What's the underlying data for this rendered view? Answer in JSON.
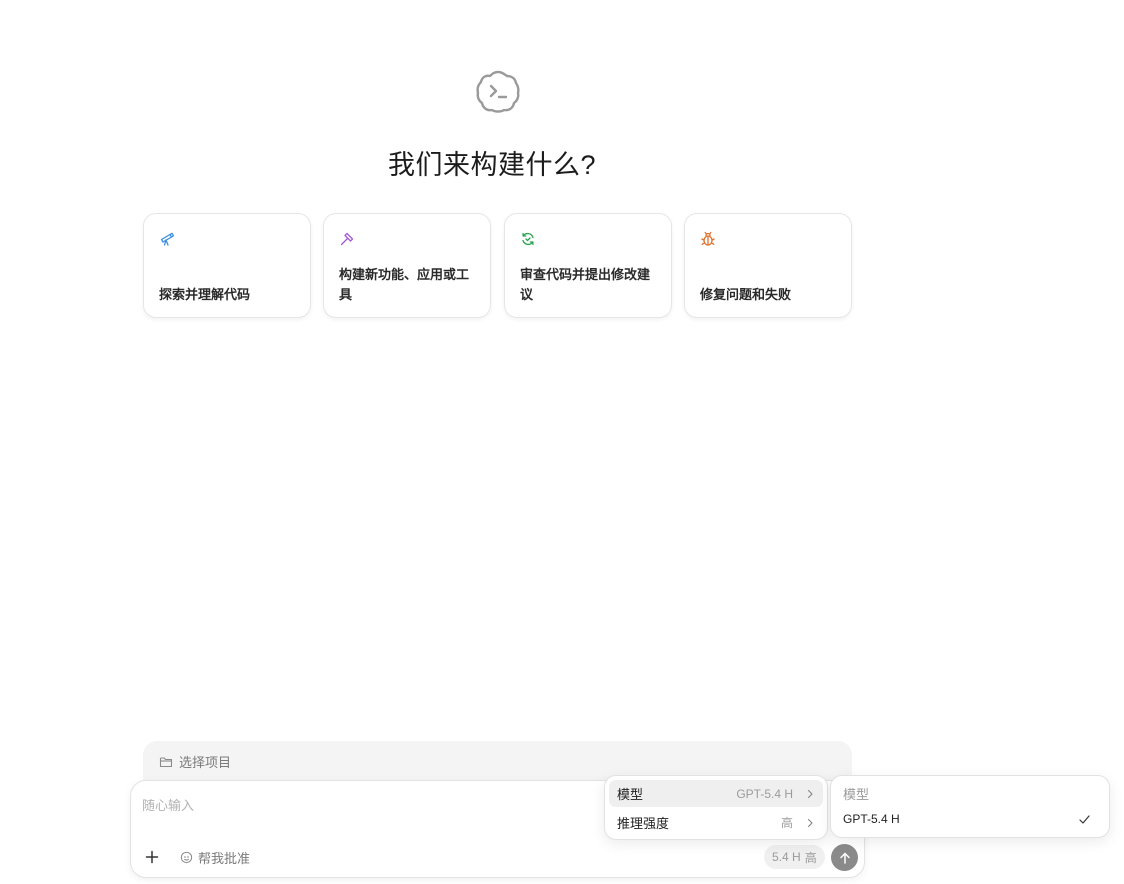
{
  "headline": "我们来构建什么?",
  "suggestions": [
    {
      "icon": "telescope-icon",
      "label": "探索并理解代码",
      "color": "#3b8fe0"
    },
    {
      "icon": "hammer-icon",
      "label": "构建新功能、应用或工具",
      "color": "#a35ad8"
    },
    {
      "icon": "review-refresh-icon",
      "label": "审查代码并提出修改建议",
      "color": "#2aa44f"
    },
    {
      "icon": "bug-icon",
      "label": "修复问题和失败",
      "color": "#e0702c"
    }
  ],
  "project_bar": {
    "label": "选择项目",
    "icon": "folder-icon"
  },
  "composer": {
    "placeholder": "随心输入",
    "approve_label": "帮我批准",
    "model_chip": {
      "model": "5.4 H",
      "effort": "高"
    }
  },
  "model_menu": {
    "items": [
      {
        "label": "模型",
        "value": "GPT-5.4 H"
      },
      {
        "label": "推理强度",
        "value": "高"
      }
    ]
  },
  "model_submenu": {
    "header": "模型",
    "options": [
      {
        "name": "GPT-5.4 H",
        "selected": true
      }
    ]
  },
  "colors": {
    "send_button": "#8a8a8a",
    "menu_highlight": "#efefef"
  }
}
